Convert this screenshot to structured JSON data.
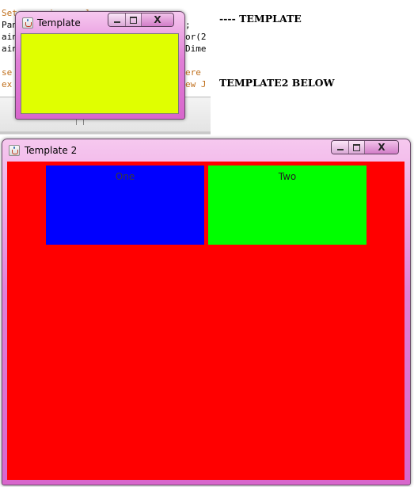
{
  "background_editor": {
    "lines": [
      "Set up main panel",
      "Pan",
      "ain",
      "ain",
      "",
      "se",
      "ex"
    ],
    "right_fragments": [
      ";",
      "or(2",
      "Dime",
      "",
      "ere",
      "ew J"
    ]
  },
  "annotations": {
    "template_note": "---- TEMPLATE",
    "template2_note": "TEMPLATE2 BELOW"
  },
  "window_template": {
    "title": "Template",
    "content_color": "#e0ff00",
    "icon": "java-cup-icon"
  },
  "window_template2": {
    "title": "Template 2",
    "content_color": "#ff0000",
    "icon": "java-cup-icon",
    "panels": [
      {
        "label": "One",
        "color": "#0000ff",
        "label_color": "#3a3a3a"
      },
      {
        "label": "Two",
        "color": "#00ff00",
        "label_color": "#222222"
      }
    ]
  },
  "window_controls": {
    "minimize_icon": "minimize-icon",
    "maximize_icon": "maximize-icon",
    "close_icon": "close-icon",
    "close_glyph": "X"
  }
}
